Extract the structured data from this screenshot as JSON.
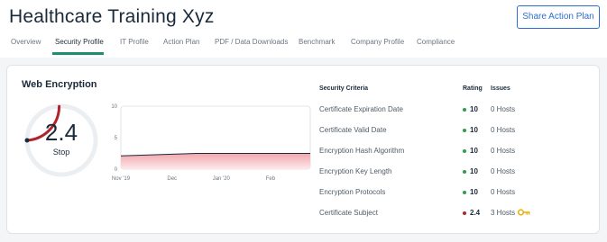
{
  "header": {
    "title": "Healthcare Training Xyz",
    "share_button": "Share Action Plan"
  },
  "tabs": [
    {
      "label": "Overview",
      "active": false
    },
    {
      "label": "Security Profile",
      "active": true
    },
    {
      "label": "IT Profile",
      "active": false
    },
    {
      "label": "Action Plan",
      "active": false
    },
    {
      "label": "PDF / Data Downloads",
      "active": false
    },
    {
      "label": "Benchmark",
      "active": false
    },
    {
      "label": "Company Profile",
      "active": false
    },
    {
      "label": "Compliance",
      "active": false
    }
  ],
  "card": {
    "title": "Web Encryption",
    "gauge": {
      "value": "2.4",
      "label": "Stop",
      "fill_fraction": 0.24,
      "color": "#b3232a"
    },
    "chart_data": {
      "type": "area",
      "x_labels": [
        "Nov '19",
        "Dec",
        "Jan '20",
        "Feb"
      ],
      "y_ticks": [
        "10",
        "5",
        "0"
      ],
      "ylim": [
        0,
        10
      ],
      "series": [
        {
          "values": [
            2.1,
            2.3,
            2.5,
            2.5,
            2.5,
            2.5
          ]
        }
      ]
    },
    "table": {
      "headers": {
        "criteria": "Security Criteria",
        "rating": "Rating",
        "issues": "Issues"
      },
      "rows": [
        {
          "criteria": "Certificate Expiration Date",
          "rating": "10",
          "issues": "0 Hosts",
          "color": "#2e9d4e"
        },
        {
          "criteria": "Certificate Valid Date",
          "rating": "10",
          "issues": "0 Hosts",
          "color": "#2e9d4e"
        },
        {
          "criteria": "Encryption Hash Algorithm",
          "rating": "10",
          "issues": "0 Hosts",
          "color": "#2e9d4e"
        },
        {
          "criteria": "Encryption Key Length",
          "rating": "10",
          "issues": "0 Hosts",
          "color": "#2e9d4e"
        },
        {
          "criteria": "Encryption Protocols",
          "rating": "10",
          "issues": "0 Hosts",
          "color": "#2e9d4e"
        },
        {
          "criteria": "Certificate Subject",
          "rating": "2.4",
          "issues": "3 Hosts",
          "color": "#b3232a",
          "icon": "key-icon"
        }
      ]
    }
  }
}
